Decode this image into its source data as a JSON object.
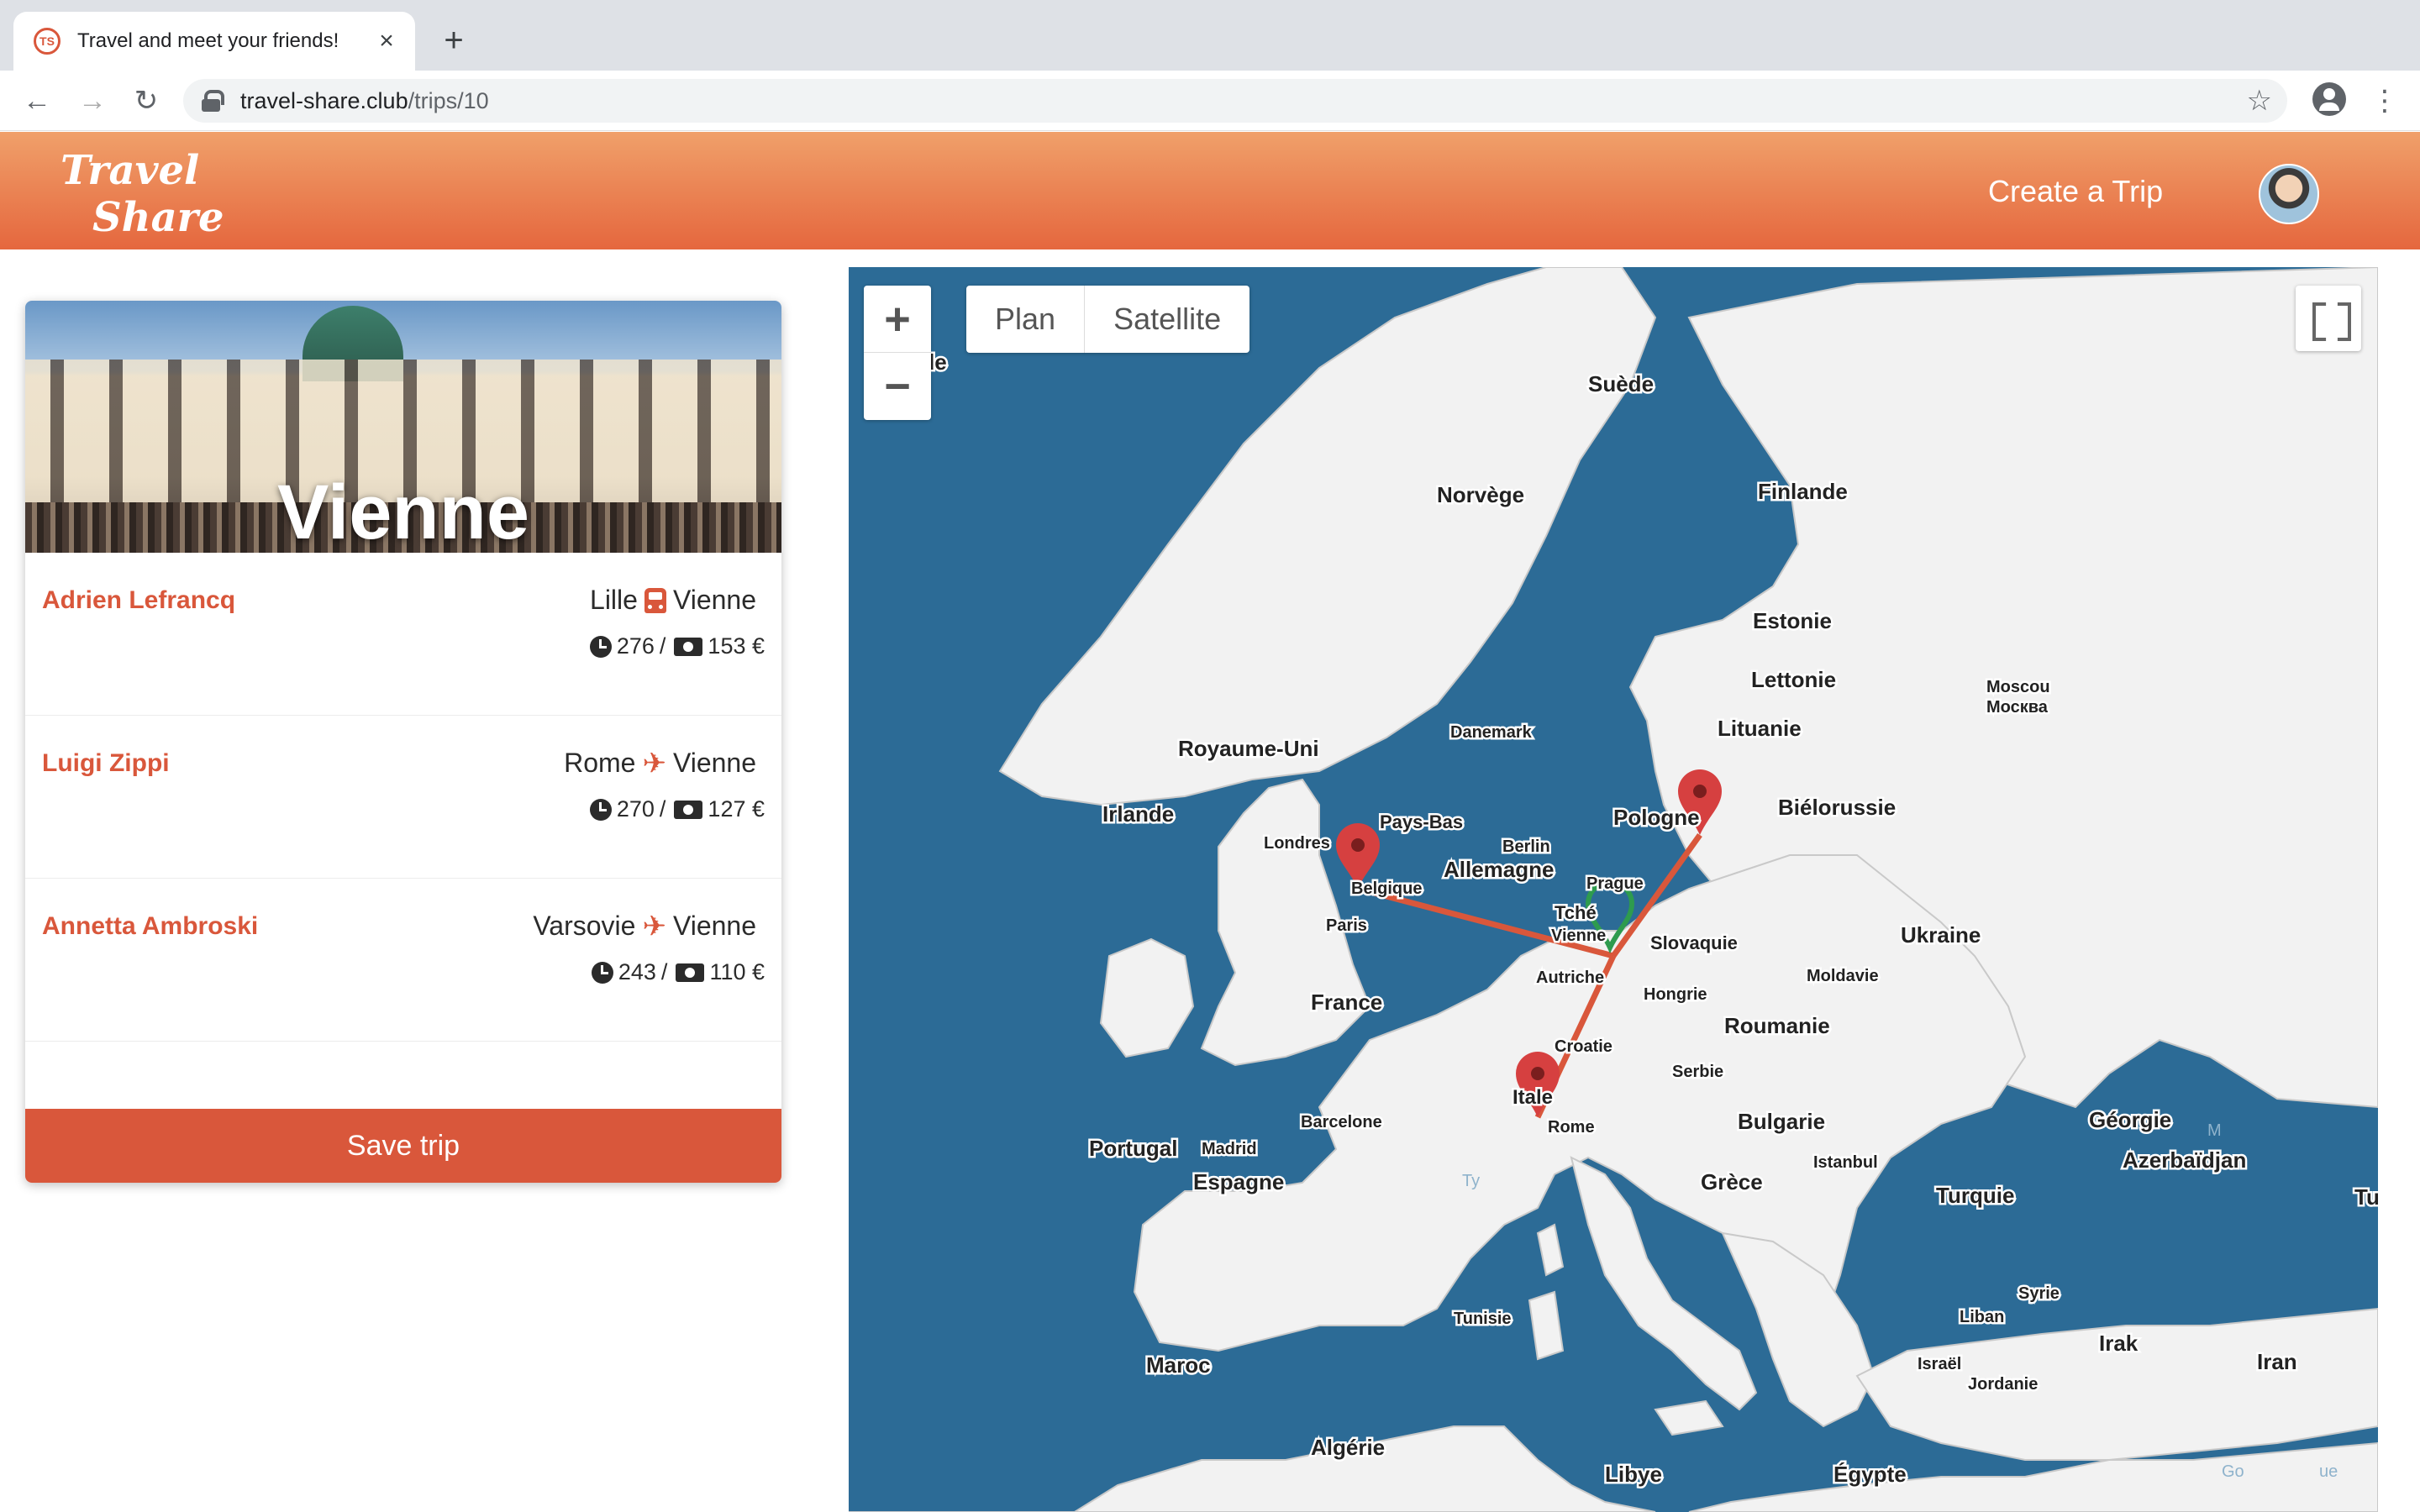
{
  "browser": {
    "tab_title": "Travel and meet your friends!",
    "favicon_text": "TS",
    "url_host": "travel-share.club",
    "url_path": "/trips/10"
  },
  "header": {
    "logo_line1": "Travel",
    "logo_line2": "Share",
    "create_trip": "Create a Trip",
    "brand_color": "#e5673e"
  },
  "trip": {
    "destination": "Vienne",
    "save_label": "Save trip",
    "participants": [
      {
        "name": "Adrien Lefrancq",
        "from": "Lille",
        "mode": "train-icon",
        "to": "Vienne",
        "duration": "276",
        "price": "153 €"
      },
      {
        "name": "Luigi Zippi",
        "from": "Rome",
        "mode": "plane-icon",
        "to": "Vienne",
        "duration": "270",
        "price": "127 €"
      },
      {
        "name": "Annetta Ambroski",
        "from": "Varsovie",
        "mode": "plane-icon",
        "to": "Vienne",
        "duration": "243",
        "price": "110 €"
      }
    ]
  },
  "map": {
    "zoom_in": "+",
    "zoom_out": "−",
    "type_plan": "Plan",
    "type_satellite": "Satellite",
    "water_color": "#2c6b96",
    "land_color": "#f2f2f2",
    "route_color": "#d9573b",
    "labels": {
      "irlande_top": "ande",
      "suede": "Suède",
      "norvege": "Norvège",
      "finlande": "Finlande",
      "estonie": "Estonie",
      "lettonie": "Lettonie",
      "moscou": "Moscou",
      "moscou_ru": "Москва",
      "lituanie": "Lituanie",
      "danemark": "Danemark",
      "royaume_uni": "Royaume-Uni",
      "irlande": "Irlande",
      "pays_bas": "Pays-Bas",
      "berlin": "Berlin",
      "pologne": "Pologne",
      "bielorussie": "Biélorussie",
      "londres": "Londres",
      "belgique": "Belgique",
      "allemagne": "Allemagne",
      "prague": "Prague",
      "tcheq": "Tché",
      "vienne": "Vienne",
      "slovaquie": "Slovaquie",
      "ukraine": "Ukraine",
      "paris": "Paris",
      "autriche": "Autriche",
      "moldavie": "Moldavie",
      "hongrie": "Hongrie",
      "france": "France",
      "roumanie": "Roumanie",
      "croatie": "Croatie",
      "serbie": "Serbie",
      "italie": "Itale",
      "barcelone": "Barcelone",
      "bulgarie": "Bulgarie",
      "georgie": "Géorgie",
      "rome": "Rome",
      "portugal": "Portugal",
      "madrid": "Madrid",
      "istanbul": "Istanbul",
      "azerbaidjan": "Azerbaïdjan",
      "espagne": "Espagne",
      "grece": "Grèce",
      "turquie": "Turquie",
      "tu": "Tu",
      "syrie": "Syrie",
      "tunisie": "Tunisie",
      "liban": "Liban",
      "maroc": "Maroc",
      "irak": "Irak",
      "israel": "Israël",
      "iran": "Iran",
      "jordanie": "Jordanie",
      "algerie": "Algérie",
      "libye": "Libye",
      "egypte": "Égypte",
      "ty": "Ty",
      "m": "M",
      "google": "Go",
      "conditions": "ue"
    }
  }
}
